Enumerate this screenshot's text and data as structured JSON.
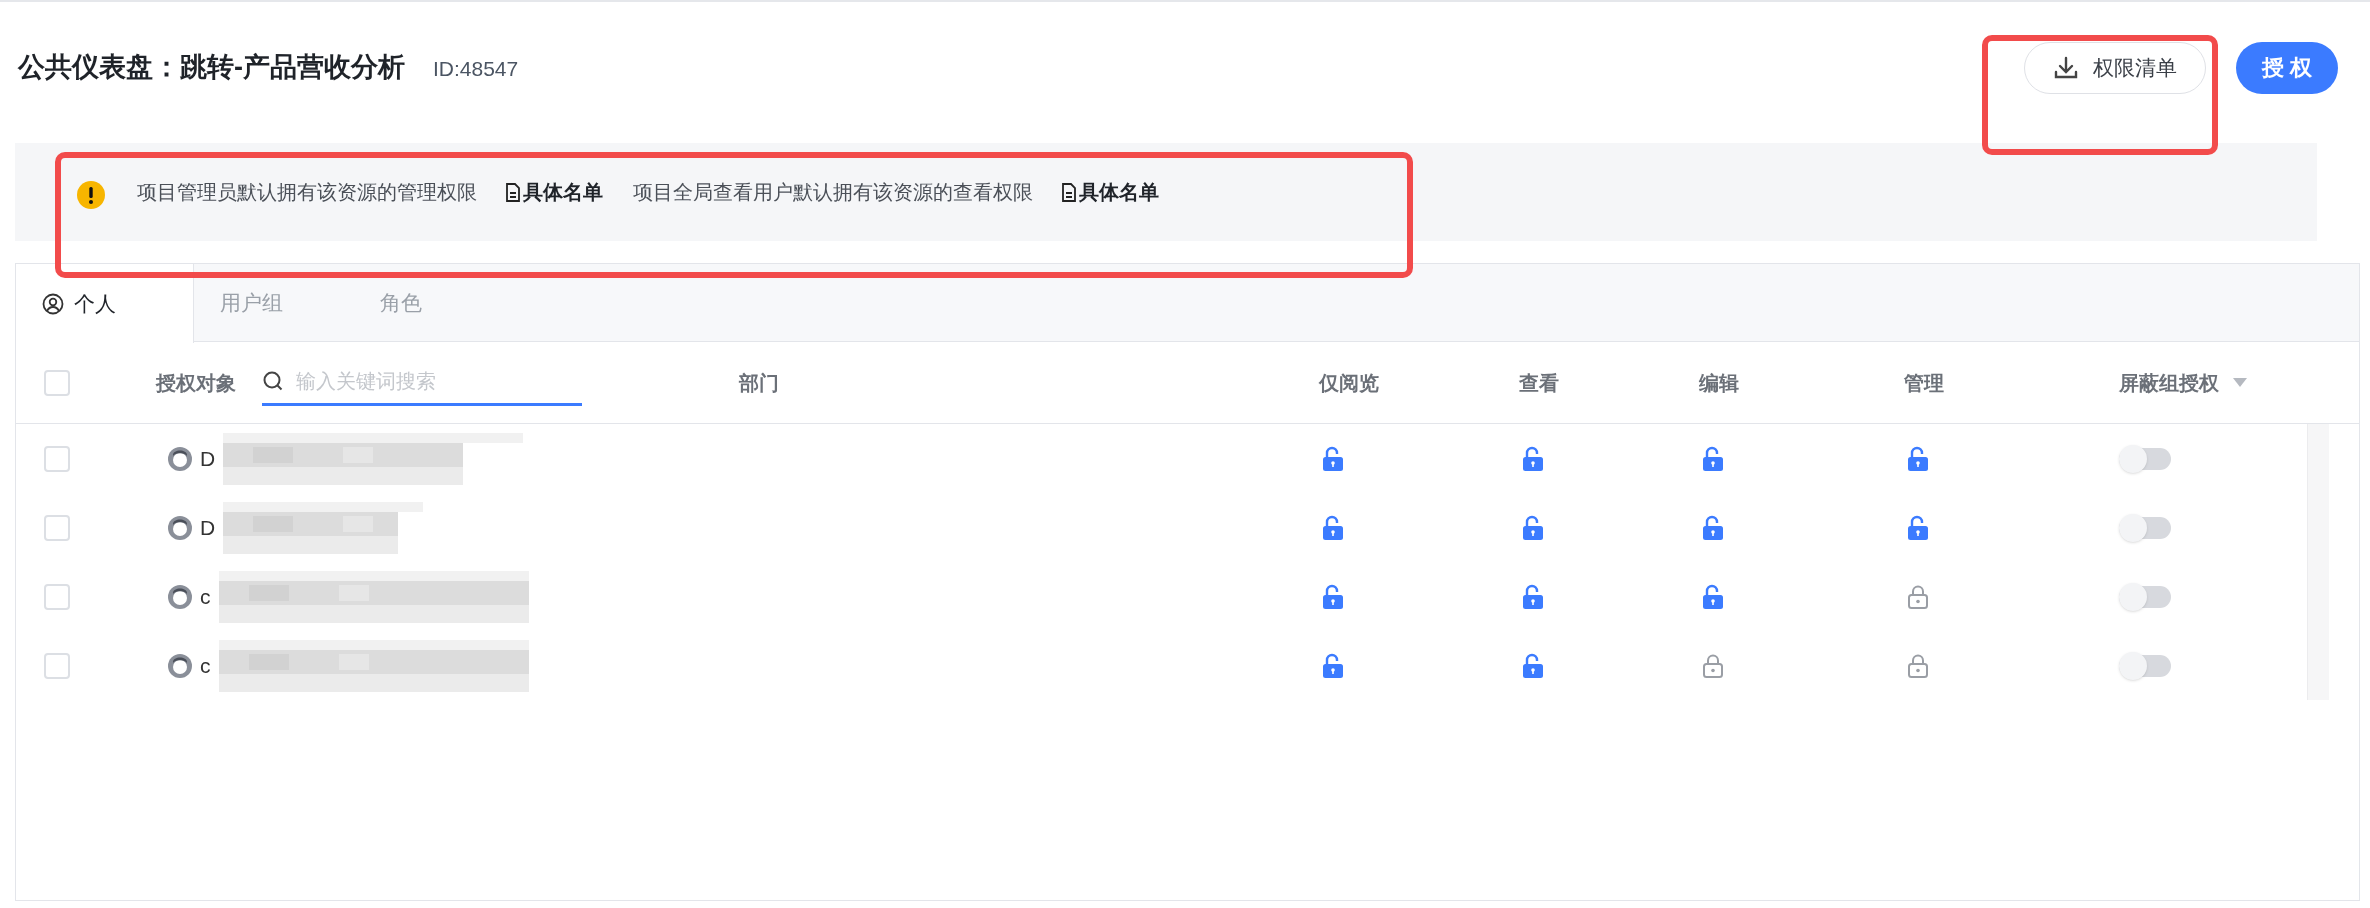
{
  "page": {
    "title": "公共仪表盘：跳转-产品营收分析",
    "id_label": "ID:48547"
  },
  "actions": [
    {
      "kind": "outline",
      "label": "权限清单"
    },
    {
      "kind": "primary",
      "label": "授 权"
    }
  ],
  "notice": [
    {
      "text": "项目管理员默认拥有该资源的管理权限",
      "link": "具体名单"
    },
    {
      "text": "项目全局查看用户默认拥有该资源的查看权限",
      "link": "具体名单"
    }
  ],
  "tabs": [
    {
      "label": "个人",
      "selected": true
    },
    {
      "label": "用户组",
      "selected": false
    },
    {
      "label": "角色",
      "selected": false
    }
  ],
  "table": {
    "select_all": {
      "checked": false
    },
    "search": {
      "placeholder": "输入关键词搜索"
    },
    "columns": [
      "授权对象",
      "部门",
      "仅阅览",
      "查看",
      "编辑",
      "管理",
      "屏蔽组授权"
    ],
    "rows": [
      {
        "checked": false,
        "name": "D",
        "permissions": [
          true,
          true,
          true,
          true
        ],
        "shield": false
      },
      {
        "checked": false,
        "name": "D",
        "permissions": [
          true,
          true,
          true,
          true
        ],
        "shield": false
      },
      {
        "checked": false,
        "name": "c",
        "permissions": [
          true,
          true,
          true,
          false
        ],
        "shield": false
      },
      {
        "checked": false,
        "name": "c",
        "permissions": [
          true,
          true,
          false,
          false
        ],
        "shield": false
      }
    ]
  }
}
